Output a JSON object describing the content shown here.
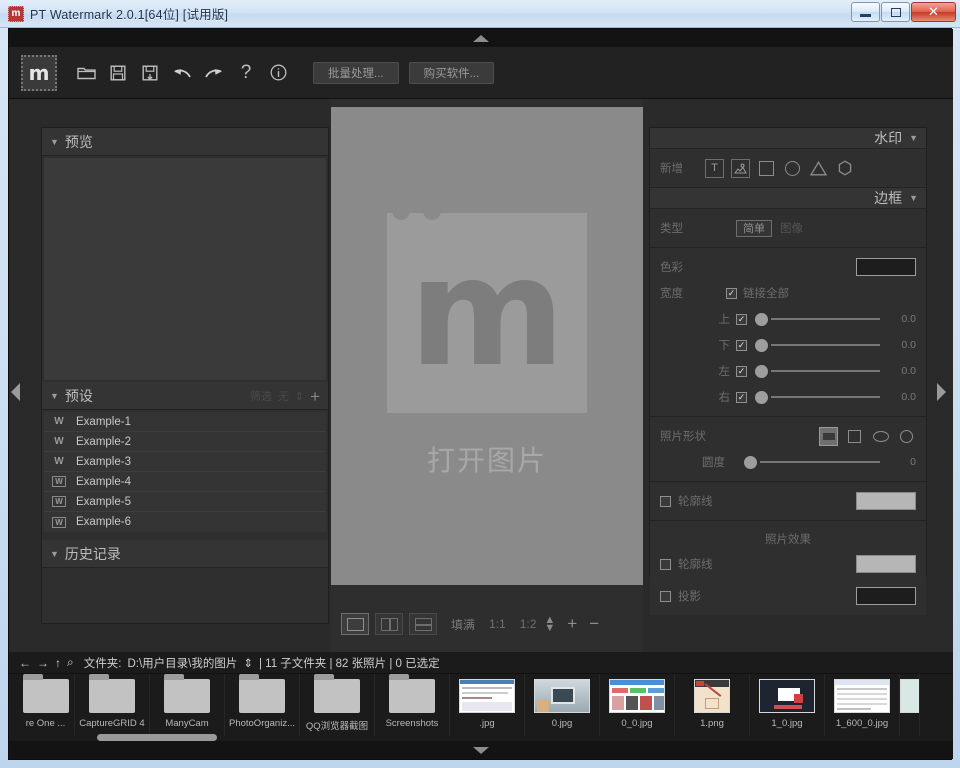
{
  "window": {
    "title": "PT Watermark 2.0.1[64位] [试用版]",
    "icon": "stamp-icon",
    "minimize": "─",
    "maximize": "□",
    "close": "✕"
  },
  "toolbar": {
    "logo": "m",
    "icons": [
      {
        "name": "open-folder-icon",
        "glyph": "🗀"
      },
      {
        "name": "save-icon",
        "glyph": "🖫"
      },
      {
        "name": "save-as-icon",
        "glyph": "🖫"
      },
      {
        "name": "undo-icon",
        "glyph": "↶"
      },
      {
        "name": "redo-icon",
        "glyph": "↷"
      },
      {
        "name": "help-icon",
        "glyph": "?"
      },
      {
        "name": "info-icon",
        "glyph": "ⓘ"
      }
    ],
    "batch_label": "批量处理...",
    "buy_label": "购买软件..."
  },
  "left_panel": {
    "preview": {
      "title": "预览",
      "caret": "▼"
    },
    "presets": {
      "title": "预设",
      "caret": "▼",
      "filter_label": "筛选",
      "filter_value": "无",
      "sort_glyph": "⇕",
      "add_glyph": "+",
      "items": [
        {
          "label": "Example-1",
          "icon": "w-icon"
        },
        {
          "label": "Example-2",
          "icon": "w-icon"
        },
        {
          "label": "Example-3",
          "icon": "w-icon"
        },
        {
          "label": "Example-4",
          "icon": "w-boxed-icon"
        },
        {
          "label": "Example-5",
          "icon": "w-boxed-icon"
        },
        {
          "label": "Example-6",
          "icon": "w-boxed-icon"
        }
      ]
    },
    "history": {
      "title": "历史记录",
      "caret": "▼"
    }
  },
  "center": {
    "open_image_label": "打开图片",
    "logo_letter": "m",
    "bottom_bar": {
      "fit_label": "填满",
      "ratio_1_1": "1:1",
      "ratio_1_2": "1:2",
      "spinner": "⇕",
      "zoom_in": "+",
      "zoom_out": "−"
    }
  },
  "right_panel": {
    "watermark": {
      "title": "水印",
      "caret": "▼",
      "add_label": "新增",
      "shapes": [
        {
          "name": "text-watermark-icon",
          "glyph": "T"
        },
        {
          "name": "image-watermark-icon",
          "glyph": "▨"
        },
        {
          "name": "square-watermark-icon",
          "glyph": "□"
        },
        {
          "name": "circle-watermark-icon",
          "glyph": "○"
        },
        {
          "name": "triangle-watermark-icon",
          "glyph": "△"
        },
        {
          "name": "hexagon-watermark-icon",
          "glyph": "⬡"
        }
      ]
    },
    "border": {
      "title": "边框",
      "caret": "▼",
      "type_label": "类型",
      "type_simple": "简单",
      "type_image": "图像",
      "color_label": "色彩",
      "color_value": "#1d1d1d",
      "width_label": "宽度",
      "link_all_label": "链接全部",
      "link_all_checked": "✓",
      "sides": [
        {
          "label": "上",
          "checked": "✓",
          "value": "0.0"
        },
        {
          "label": "下",
          "checked": "✓",
          "value": "0.0"
        },
        {
          "label": "左",
          "checked": "✓",
          "value": "0.0"
        },
        {
          "label": "右",
          "checked": "✓",
          "value": "0.0"
        }
      ],
      "photo_shape_label": "照片形状",
      "photo_shapes": [
        {
          "name": "shape-rounded-rect-icon",
          "glyph": "▭"
        },
        {
          "name": "shape-square-icon",
          "glyph": "□"
        },
        {
          "name": "shape-ellipse-icon",
          "glyph": "◯"
        },
        {
          "name": "shape-circle-icon",
          "glyph": "◎"
        }
      ],
      "roundness_label": "圆度",
      "roundness_value": "0",
      "outline_label": "轮廓线",
      "outline_color": "#b6b6b6"
    },
    "photo_effects": {
      "title": "照片效果",
      "outline_label": "轮廓线",
      "outline_color": "#b6b6b6",
      "shadow_label": "投影",
      "shadow_color": "#1d1d1d"
    }
  },
  "browser": {
    "nav": {
      "back": "←",
      "forward": "→",
      "up": "↑",
      "search": "⌕"
    },
    "folder_label": "文件夹:",
    "folder_path": "D:\\用户目录\\我的图片",
    "path_spinner": "⇕",
    "stats": "| 11 子文件夹 | 82 张照片 | 0 已选定",
    "thumbnails": [
      {
        "label": "re One ...",
        "type": "folder"
      },
      {
        "label": "CaptureGRID 4",
        "type": "folder"
      },
      {
        "label": "ManyCam",
        "type": "folder"
      },
      {
        "label": "PhotoOrganiz...",
        "type": "folder"
      },
      {
        "label": "QQ浏览器截图",
        "type": "folder"
      },
      {
        "label": "Screenshots",
        "type": "folder"
      },
      {
        "label": ".jpg",
        "type": "image"
      },
      {
        "label": "0.jpg",
        "type": "image"
      },
      {
        "label": "0_0.jpg",
        "type": "image"
      },
      {
        "label": "1.png",
        "type": "image"
      },
      {
        "label": "1_0.jpg",
        "type": "image"
      },
      {
        "label": "1_600_0.jpg",
        "type": "image"
      }
    ]
  },
  "collapse": {
    "up": "▲",
    "down": "▼",
    "left": "◀",
    "right": "▶"
  }
}
